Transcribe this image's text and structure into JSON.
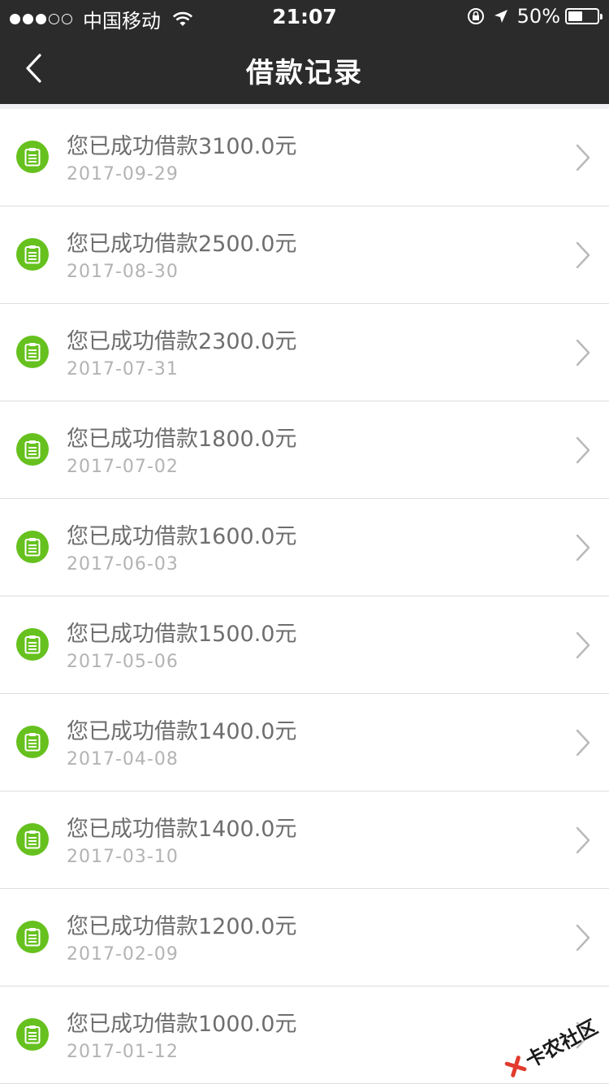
{
  "status_bar": {
    "carrier": "中国移动",
    "time": "21:07",
    "battery_text": "50%",
    "battery_level": 0.5
  },
  "header": {
    "title": "借款记录"
  },
  "records": [
    {
      "text": "您已成功借款3100.0元",
      "date": "2017-09-29"
    },
    {
      "text": "您已成功借款2500.0元",
      "date": "2017-08-30"
    },
    {
      "text": "您已成功借款2300.0元",
      "date": "2017-07-31"
    },
    {
      "text": "您已成功借款1800.0元",
      "date": "2017-07-02"
    },
    {
      "text": "您已成功借款1600.0元",
      "date": "2017-06-03"
    },
    {
      "text": "您已成功借款1500.0元",
      "date": "2017-05-06"
    },
    {
      "text": "您已成功借款1400.0元",
      "date": "2017-04-08"
    },
    {
      "text": "您已成功借款1400.0元",
      "date": "2017-03-10"
    },
    {
      "text": "您已成功借款1200.0元",
      "date": "2017-02-09"
    },
    {
      "text": "您已成功借款1000.0元",
      "date": "2017-01-12"
    }
  ],
  "watermark": {
    "text": "卡农社区"
  },
  "colors": {
    "header_bg": "#2b2b2b",
    "icon_green": "#66c11e",
    "amount_text": "#6e6e6e",
    "date_text": "#b3b3b3"
  },
  "icons": {
    "record": "clipboard-icon",
    "row_arrow": "chevron-right-icon",
    "back": "chevron-left-icon"
  }
}
